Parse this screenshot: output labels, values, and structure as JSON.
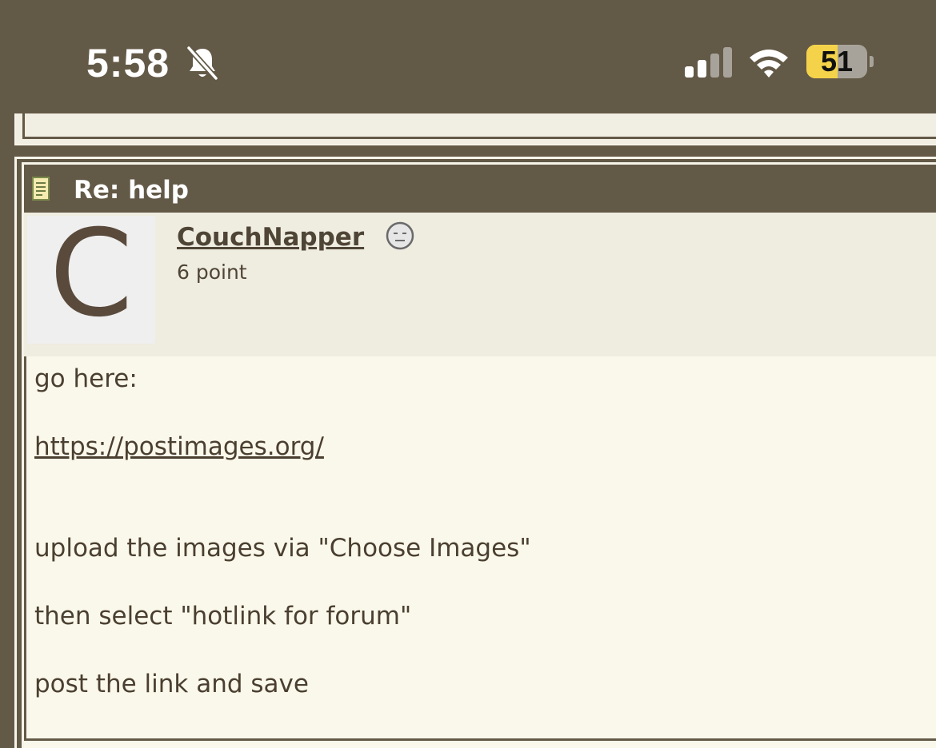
{
  "status_bar": {
    "time": "5:58",
    "battery_level": 51,
    "battery_label": "51",
    "icons": [
      "bell-slash-icon",
      "cellular-signal-icon",
      "wifi-icon",
      "battery-icon"
    ]
  },
  "post": {
    "title": "Re: help",
    "icon": "post-document-icon",
    "author": {
      "avatar_letter": "C",
      "username": "CouchNapper",
      "points": "6 point",
      "status_icon": "neutral-face-icon"
    },
    "body": {
      "line1": "go here:",
      "link": "https://postimages.org/",
      "line3": "upload the images via \"Choose Images\"",
      "line4": "then select \"hotlink for forum\"",
      "line5": "post the link and save"
    }
  },
  "colors": {
    "frame": "#635947",
    "author_panel": "#efece0",
    "body_bg": "#faf8ea",
    "text": "#4a3f30"
  }
}
